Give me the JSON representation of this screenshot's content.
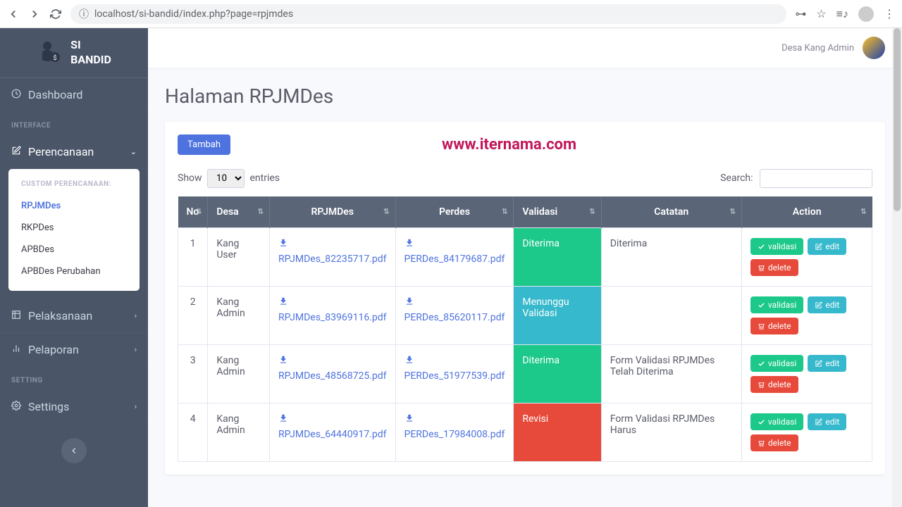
{
  "browser": {
    "url": "localhost/si-bandid/index.php?page=rpjmdes"
  },
  "brand": {
    "line1": "SI",
    "line2": "BANDID"
  },
  "sidebar": {
    "dashboard": "Dashboard",
    "interface_header": "INTERFACE",
    "perencanaan": "Perencanaan",
    "submenu_header": "CUSTOM PERENCANAAN:",
    "submenu": [
      "RPJMDes",
      "RKPDes",
      "APBDes",
      "APBDes Perubahan"
    ],
    "pelaksanaan": "Pelaksanaan",
    "pelaporan": "Pelaporan",
    "setting_header": "SETTING",
    "settings": "Settings"
  },
  "topbar": {
    "user": "Desa Kang Admin"
  },
  "page": {
    "title": "Halaman RPJMDes",
    "watermark": "www.iternama.com",
    "tambah_btn": "Tambah"
  },
  "table_controls": {
    "show": "Show",
    "entries": "entries",
    "page_size": "10",
    "search": "Search:"
  },
  "columns": [
    "No",
    "Desa",
    "RPJMDes",
    "Perdes",
    "Validasi",
    "Catatan",
    "Action"
  ],
  "rows": [
    {
      "no": "1",
      "desa": "Kang User",
      "rpjmdes": "RPJMDes_82235717.pdf",
      "perdes": "PERDes_84179687.pdf",
      "validasi": "Diterima",
      "status_class": "status-diterima",
      "catatan": "Diterima"
    },
    {
      "no": "2",
      "desa": "Kang Admin",
      "rpjmdes": "RPJMDes_83969116.pdf",
      "perdes": "PERDes_85620117.pdf",
      "validasi": "Menunggu Validasi",
      "status_class": "status-menunggu",
      "catatan": ""
    },
    {
      "no": "3",
      "desa": "Kang Admin",
      "rpjmdes": "RPJMDes_48568725.pdf",
      "perdes": "PERDes_51977539.pdf",
      "validasi": "Diterima",
      "status_class": "status-diterima",
      "catatan": "Form Validasi RPJMDes Telah Diterima"
    },
    {
      "no": "4",
      "desa": "Kang Admin",
      "rpjmdes": "RPJMDes_64440917.pdf",
      "perdes": "PERDes_17984008.pdf",
      "validasi": "Revisi",
      "status_class": "status-revisi",
      "catatan": "Form Validasi RPJMDes Harus"
    }
  ],
  "actions": {
    "validasi": "validasi",
    "edit": "edit",
    "delete": "delete"
  }
}
